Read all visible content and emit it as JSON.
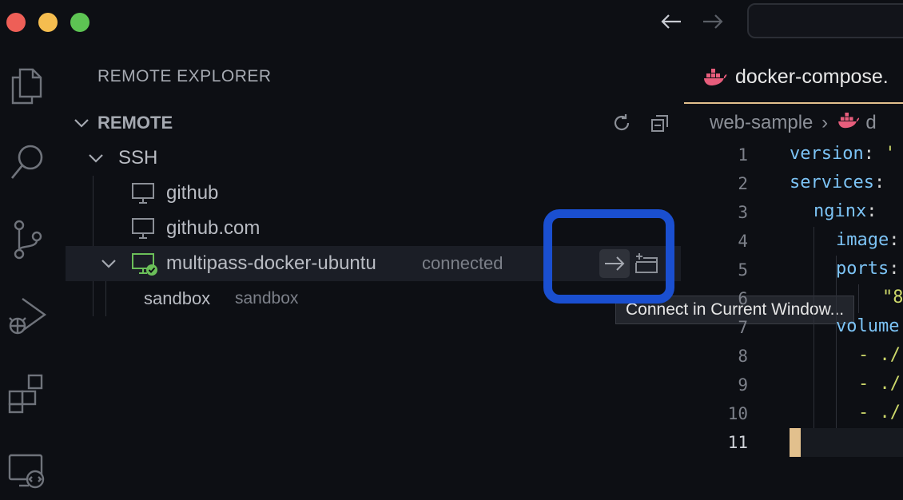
{
  "titlebar": {
    "back_icon": "arrow-left-icon",
    "forward_icon": "arrow-right-icon"
  },
  "activity_bar": [
    {
      "name": "explorer-icon"
    },
    {
      "name": "search-icon"
    },
    {
      "name": "source-control-icon"
    },
    {
      "name": "run-debug-icon"
    },
    {
      "name": "extensions-icon"
    },
    {
      "name": "remote-explorer-icon"
    }
  ],
  "sidebar": {
    "title": "REMOTE EXPLORER",
    "section": "REMOTE",
    "group": "SSH",
    "hosts": [
      {
        "label": "github"
      },
      {
        "label": "github.com"
      },
      {
        "label": "multipass-docker-ubuntu",
        "status": "connected"
      }
    ],
    "folder": {
      "label": "sandbox",
      "description": "sandbox"
    },
    "tooltip": "Connect in Current Window..."
  },
  "editor": {
    "tab": "docker-compose.",
    "breadcrumb_folder": "web-sample",
    "breadcrumb_file": "d",
    "line_numbers": [
      "1",
      "2",
      "3",
      "4",
      "5",
      "6",
      "7",
      "8",
      "9",
      "10",
      "11"
    ],
    "lines": {
      "l1_key": "version",
      "l1_val": "'",
      "l2_key": "services",
      "l3_key": "nginx",
      "l4_key": "image",
      "l5_key": "ports",
      "l6_val": "\"8",
      "l7_key": "volume",
      "l8_val": "- ./",
      "l9_val": "- ./",
      "l10_val": "- ./"
    }
  },
  "colors": {
    "accent_highlight": "#1a4fd0",
    "tab_underline": "#e2c08d",
    "connected_icon": "#6bbf59"
  }
}
